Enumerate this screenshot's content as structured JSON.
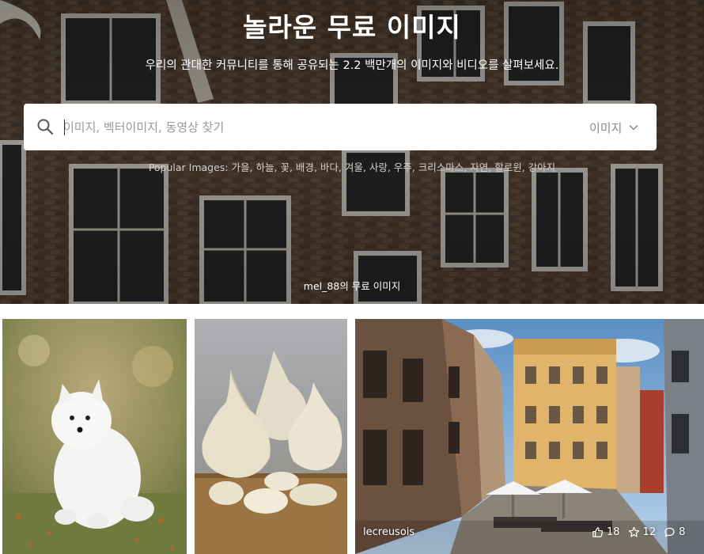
{
  "hero": {
    "title": "놀라운 무료 이미지",
    "subtitle": "우리의 관대한 커뮤니티를 통해 공유되는 2.2 백만개의 이미지와 비디오를 살펴보세요.",
    "credit": "mel_88의 무료 이미지"
  },
  "search": {
    "placeholder": "이미지, 벡터이미지, 동영상 찾기",
    "value": "",
    "type_selected": "이미지",
    "icon": "search-icon"
  },
  "popular": {
    "label": "Popular Images:",
    "tags": [
      "가을",
      "하늘",
      "꽃",
      "배경",
      "바다",
      "겨울",
      "사랑",
      "우주",
      "크리스마스",
      "자연",
      "할로윈",
      "강아지"
    ]
  },
  "gallery": {
    "tiles": [
      {
        "subject": "dog"
      },
      {
        "subject": "garlic"
      },
      {
        "subject": "street",
        "user": "lecreusois",
        "likes": "18",
        "favorites": "12",
        "comments": "8"
      }
    ]
  },
  "colors": {
    "text_light": "#ffffff",
    "placeholder": "#999999"
  }
}
